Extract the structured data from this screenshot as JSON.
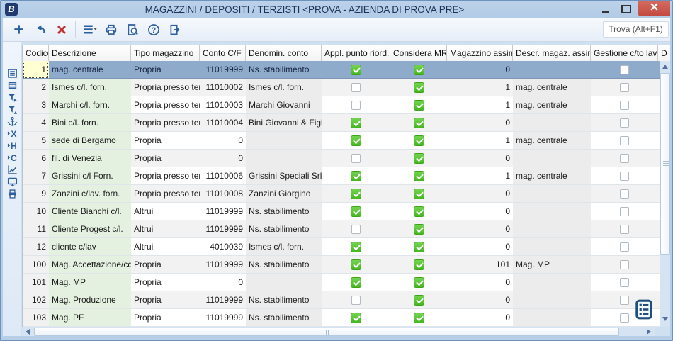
{
  "window": {
    "logo_letter": "B",
    "title": "MAGAZZINI / DEPOSITI / TERZISTI <PROVA - AZIENDA DI PROVA PRE>",
    "controls": [
      {
        "name": "minimize-button"
      },
      {
        "name": "maximize-button"
      },
      {
        "name": "close-button"
      }
    ]
  },
  "toolbar": {
    "buttons": [
      {
        "name": "add-button",
        "icon": "add"
      },
      {
        "name": "undo-button",
        "icon": "undo"
      },
      {
        "name": "delete-button",
        "icon": "delete"
      },
      {
        "name": "menu-button",
        "icon": "menu"
      },
      {
        "name": "print-button",
        "icon": "print"
      },
      {
        "name": "print-preview-button",
        "icon": "preview"
      },
      {
        "name": "help-button",
        "icon": "help"
      },
      {
        "name": "exit-button",
        "icon": "exit"
      }
    ],
    "find_label": "Trova (Alt+F1)"
  },
  "sidebar": {
    "items": [
      {
        "name": "form-view-icon",
        "icon": "formview"
      },
      {
        "name": "table-view-icon",
        "icon": "tableview"
      },
      {
        "name": "filter-icon",
        "icon": "filter"
      },
      {
        "name": "filter-remove-icon",
        "icon": "filter2"
      },
      {
        "name": "anchor-icon",
        "icon": "anchor"
      },
      {
        "name": "goto-x-icon",
        "icon": "gotox"
      },
      {
        "name": "goto-h-icon",
        "icon": "gotoh"
      },
      {
        "name": "goto-c-icon",
        "icon": "gotoc"
      },
      {
        "name": "chart-icon",
        "icon": "chart"
      },
      {
        "name": "monitor-icon",
        "icon": "monitor"
      },
      {
        "name": "print-row-icon",
        "icon": "printer2"
      }
    ]
  },
  "table": {
    "columns": [
      {
        "id": "codice",
        "label": "Codice",
        "width": 37,
        "align": "right",
        "bg": "bgfix"
      },
      {
        "id": "descrizione",
        "label": "Descrizione",
        "width": 116,
        "align": "left",
        "bg": "bggreen"
      },
      {
        "id": "tipo",
        "label": "Tipo magazzino",
        "width": 97,
        "align": "left",
        "bg": "alt"
      },
      {
        "id": "conto",
        "label": "Conto C/F",
        "width": 65,
        "align": "right",
        "bg": "alt"
      },
      {
        "id": "denomin",
        "label": "Denomin. conto",
        "width": 107,
        "align": "left",
        "bg": "bggray"
      },
      {
        "id": "appl",
        "label": "Appl. punto riord.",
        "width": 97,
        "align": "center",
        "bg": "alt",
        "type": "check"
      },
      {
        "id": "mrp",
        "label": "Considera MRP",
        "width": 80,
        "align": "center",
        "bg": "alt",
        "type": "check"
      },
      {
        "id": "mag_assim",
        "label": "Magazzino assim.",
        "width": 93,
        "align": "right",
        "bg": "alt"
      },
      {
        "id": "descr_assim",
        "label": "Descr. magaz. assim.",
        "width": 110,
        "align": "left",
        "bg": "bggray"
      },
      {
        "id": "gestione",
        "label": "Gestione c/to lav.",
        "width": 95,
        "align": "center",
        "bg": "alt",
        "type": "check"
      },
      {
        "id": "d_cut",
        "label": "D",
        "width": 19,
        "align": "left",
        "bg": "alt"
      }
    ],
    "rows": [
      {
        "codice": "1",
        "descrizione": "mag. centrale",
        "tipo": "Propria",
        "conto": "11019999",
        "denomin": "Ns. stabilimento",
        "appl": true,
        "mrp": true,
        "mag_assim": "0",
        "descr_assim": "",
        "gestione": false,
        "selected": true
      },
      {
        "codice": "2",
        "descrizione": "Ismes c/l. forn.",
        "tipo": "Propria presso terzi",
        "conto": "11010002",
        "denomin": "Ismes c/l. forn.",
        "appl": false,
        "mrp": true,
        "mag_assim": "1",
        "descr_assim": "mag. centrale",
        "gestione": false
      },
      {
        "codice": "3",
        "descrizione": "Marchi c/l. forn.",
        "tipo": "Propria presso terzi",
        "conto": "11010003",
        "denomin": "Marchi Giovanni",
        "appl": false,
        "mrp": true,
        "mag_assim": "1",
        "descr_assim": "mag. centrale",
        "gestione": false
      },
      {
        "codice": "4",
        "descrizione": "Bini c/l. forn.",
        "tipo": "Propria presso terzi",
        "conto": "11010004",
        "denomin": "Bini Giovanni & Figlio",
        "appl": true,
        "mrp": true,
        "mag_assim": "0",
        "descr_assim": "",
        "gestione": false
      },
      {
        "codice": "5",
        "descrizione": "sede di Bergamo",
        "tipo": "Propria",
        "conto": "0",
        "denomin": "",
        "appl": true,
        "mrp": true,
        "mag_assim": "1",
        "descr_assim": "mag. centrale",
        "gestione": false
      },
      {
        "codice": "6",
        "descrizione": "fil. di Venezia",
        "tipo": "Propria",
        "conto": "0",
        "denomin": "",
        "appl": false,
        "mrp": true,
        "mag_assim": "0",
        "descr_assim": "",
        "gestione": false
      },
      {
        "codice": "7",
        "descrizione": "Grissini c/l Forn.",
        "tipo": "Propria presso terzi",
        "conto": "11010006",
        "denomin": "Grissini Speciali Srl",
        "appl": true,
        "mrp": true,
        "mag_assim": "1",
        "descr_assim": "mag. centrale",
        "gestione": false
      },
      {
        "codice": "9",
        "descrizione": "Zanzini c/lav. forn.",
        "tipo": "Propria presso terzi",
        "conto": "11010008",
        "denomin": "Zanzini Giorgino",
        "appl": true,
        "mrp": true,
        "mag_assim": "0",
        "descr_assim": "",
        "gestione": false
      },
      {
        "codice": "10",
        "descrizione": "Cliente Bianchi c/l.",
        "tipo": "Altrui",
        "conto": "11019999",
        "denomin": "Ns. stabilimento",
        "appl": true,
        "mrp": true,
        "mag_assim": "0",
        "descr_assim": "",
        "gestione": false
      },
      {
        "codice": "11",
        "descrizione": "Cliente Progest c/l.",
        "tipo": "Altrui",
        "conto": "11019999",
        "denomin": "Ns. stabilimento",
        "appl": false,
        "mrp": true,
        "mag_assim": "0",
        "descr_assim": "",
        "gestione": false
      },
      {
        "codice": "12",
        "descrizione": "cliente c/lav",
        "tipo": "Altrui",
        "conto": "4010039",
        "denomin": "Ismes c/l. forn.",
        "appl": true,
        "mrp": true,
        "mag_assim": "0",
        "descr_assim": "",
        "gestione": false
      },
      {
        "codice": "100",
        "descrizione": "Mag. Accettazione/cq",
        "tipo": "Propria",
        "conto": "11019999",
        "denomin": "Ns. stabilimento",
        "appl": true,
        "mrp": true,
        "mag_assim": "101",
        "descr_assim": "Mag. MP",
        "gestione": false
      },
      {
        "codice": "101",
        "descrizione": "Mag. MP",
        "tipo": "Propria",
        "conto": "0",
        "denomin": "",
        "appl": true,
        "mrp": true,
        "mag_assim": "0",
        "descr_assim": "",
        "gestione": false
      },
      {
        "codice": "102",
        "descrizione": "Mag. Produzione",
        "tipo": "Propria",
        "conto": "11019999",
        "denomin": "Ns. stabilimento",
        "appl": false,
        "mrp": true,
        "mag_assim": "0",
        "descr_assim": "",
        "gestione": false
      },
      {
        "codice": "103",
        "descrizione": "Mag. PF",
        "tipo": "Propria",
        "conto": "11019999",
        "denomin": "Ns. stabilimento",
        "appl": true,
        "mrp": true,
        "mag_assim": "0",
        "descr_assim": "",
        "gestione": false
      }
    ]
  },
  "colors": {
    "frame": "#b7cee7",
    "selected_row": "#8fabcc",
    "check_green": "#45b81f",
    "row_alt": "#f2f2f2",
    "col_green": "#e5f1e0",
    "col_gray": "#ececec",
    "focus_cell": "#ffffd2",
    "accent_blue": "#2e5f9e",
    "danger_red": "#bf3434"
  }
}
